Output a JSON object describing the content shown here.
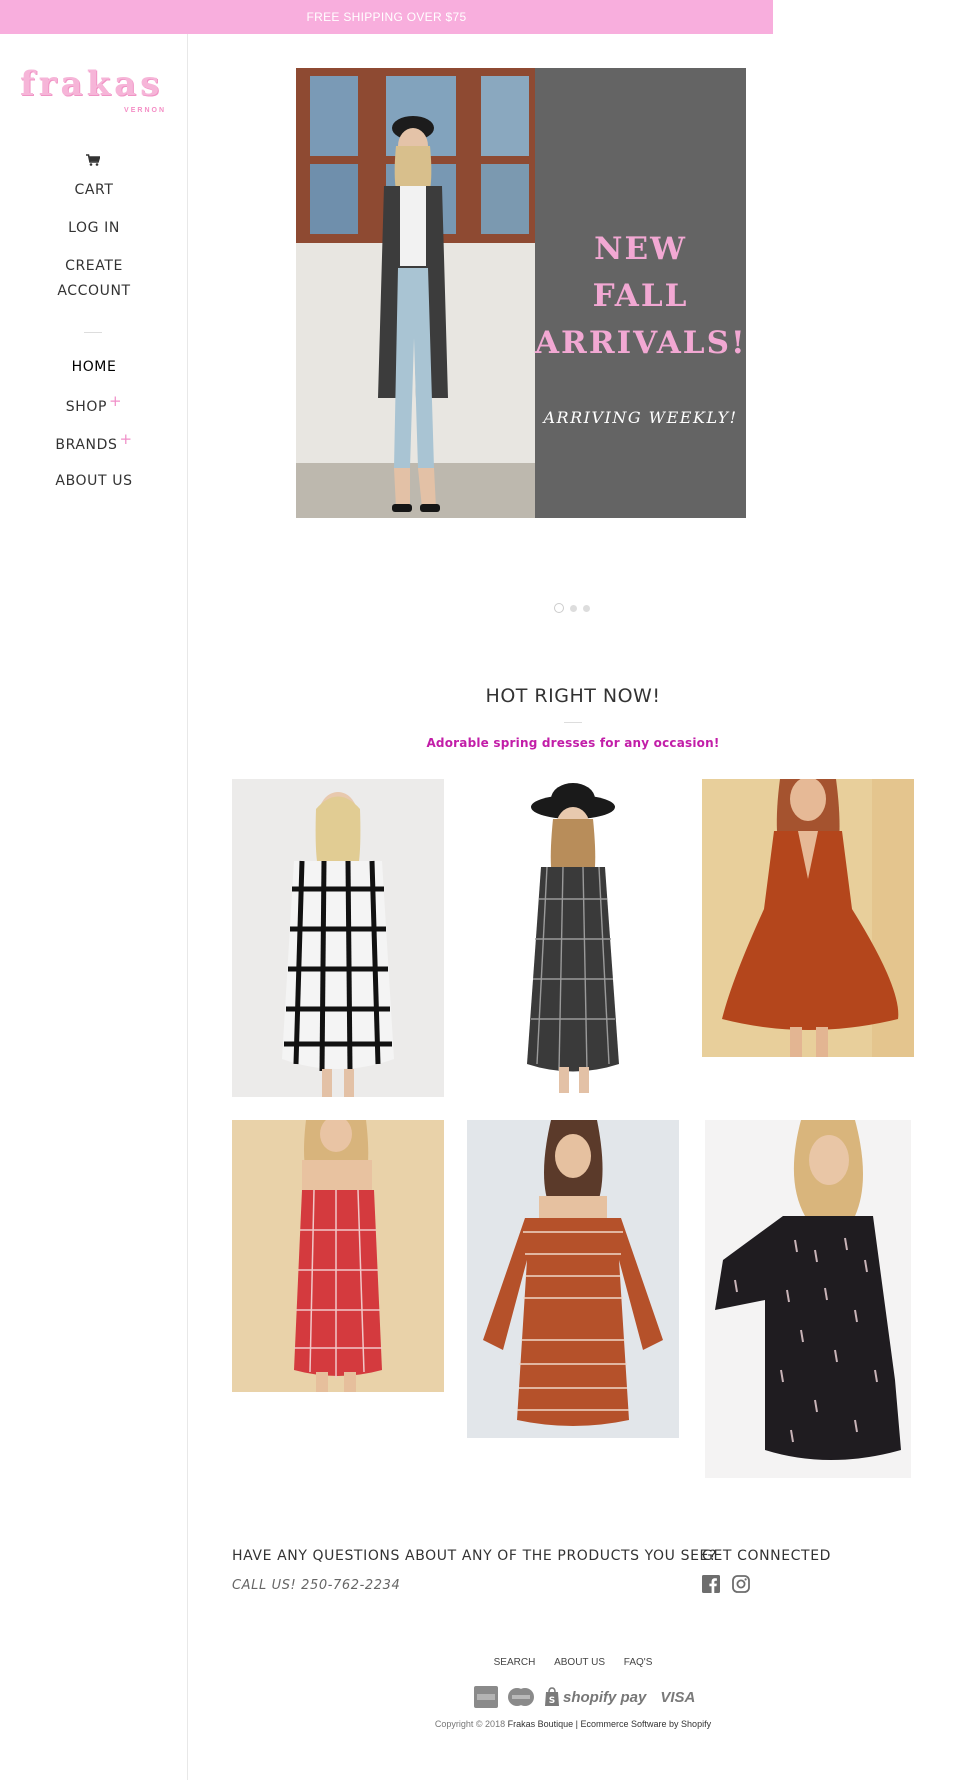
{
  "announcement": "FREE SHIPPING OVER $75",
  "logo": {
    "text": "frakas",
    "sub": "VERNON"
  },
  "sidebar": {
    "cart": "CART",
    "login": "LOG IN",
    "create_1": "CREATE",
    "create_2": "ACCOUNT",
    "nav": [
      {
        "label": "HOME",
        "active": true
      },
      {
        "label": "SHOP",
        "has_children": true
      },
      {
        "label": "BRANDS",
        "has_children": true
      },
      {
        "label": "ABOUT US"
      }
    ]
  },
  "hero": {
    "title_1": "NEW",
    "title_2": "FALL",
    "title_3": "ARRIVALS!",
    "subtitle": "ARRIVING WEEKLY!",
    "slides": 3,
    "active_slide": 1
  },
  "featured": {
    "title": "HOT RIGHT NOW!",
    "subtitle": "Adorable spring dresses for any occasion!"
  },
  "footer": {
    "question": "HAVE ANY QUESTIONS ABOUT ANY OF THE PRODUCTS YOU SEE?",
    "call": "CALL US! 250-762-2234",
    "connect": "GET CONNECTED",
    "social": [
      "facebook-icon",
      "instagram-icon"
    ],
    "links": [
      "SEARCH",
      "ABOUT US",
      "FAQ'S"
    ],
    "payments": [
      "american-express-icon",
      "mastercard-icon",
      "shopify-pay-icon",
      "visa-icon"
    ],
    "shopify_pay": "shopify pay",
    "visa": "VISA",
    "copyright_prefix": "Copyright © 2018",
    "copyright_shop": "Frakas Boutique",
    "copyright_sep": "|",
    "copyright_link": "Ecommerce Software by Shopify"
  },
  "colors": {
    "accent": "#f8aedd",
    "pink_text": "#f2a8d3",
    "magenta": "#c21ea8",
    "panel": "#646464"
  }
}
